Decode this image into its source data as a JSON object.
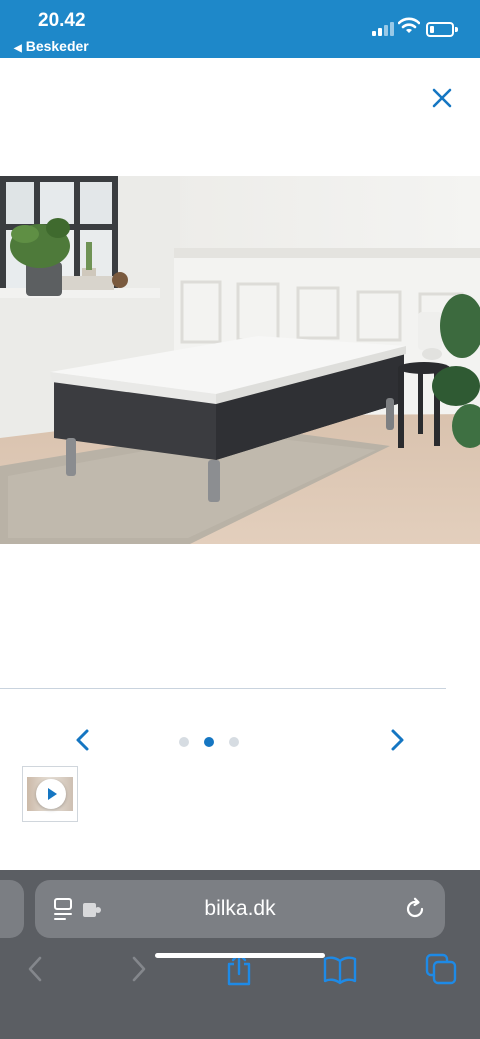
{
  "status_bar": {
    "time": "20.42",
    "back_app_label": "Beskeder",
    "signal_bars_lit": 2,
    "signal_bars_total": 4,
    "battery_level": 0.2
  },
  "gallery": {
    "close_icon": "close-icon",
    "main_image": "product-photo-single-bed-dark-grey-with-mattress-topper",
    "prev_icon": "chevron-left-icon",
    "next_icon": "chevron-right-icon",
    "dots_count": 3,
    "active_dot_index": 1,
    "thumbnail_icon": "play-icon"
  },
  "browser": {
    "url": "bilka.dk",
    "toolbar_icons": [
      "back-icon",
      "forward-icon",
      "share-icon",
      "bookmarks-icon",
      "tabs-icon"
    ]
  },
  "colors": {
    "status_bar": "#1e88c9",
    "accent": "#1576c2",
    "browser_bar": "#5b5e63"
  }
}
